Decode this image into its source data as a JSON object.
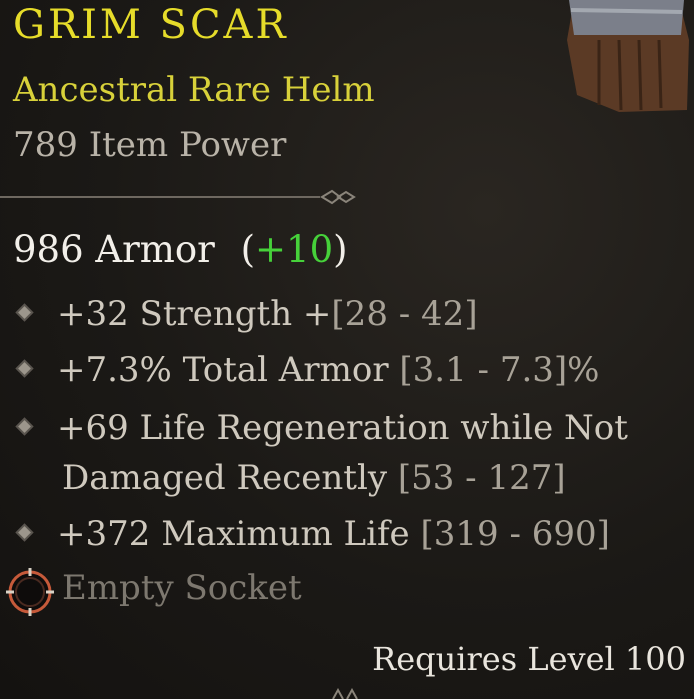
{
  "item": {
    "name": "GRIM SCAR",
    "type": "Ancestral Rare Helm",
    "item_power": "789 Item Power",
    "armor_value": "986 Armor",
    "armor_bonus_open": "(",
    "armor_bonus": "+10",
    "armor_bonus_close": ")"
  },
  "affixes": [
    {
      "text": "+32 Strength +",
      "range": "[28 - 42]"
    },
    {
      "text": "+7.3% Total Armor ",
      "range": "[3.1 - 7.3]%"
    },
    {
      "text": "+69 Life Regeneration while Not",
      "range": ""
    },
    {
      "text": "Damaged Recently ",
      "range": "[53 - 127]"
    },
    {
      "text": "+372 Maximum Life ",
      "range": "[319 - 690]"
    }
  ],
  "socket": {
    "label": "Empty Socket",
    "icon": "socket-icon"
  },
  "requirement": "Requires Level 100",
  "colors": {
    "title": "#e6dc2a",
    "rare": "#d8d13a",
    "bonus": "#46d13a",
    "background": "#1b1916"
  }
}
